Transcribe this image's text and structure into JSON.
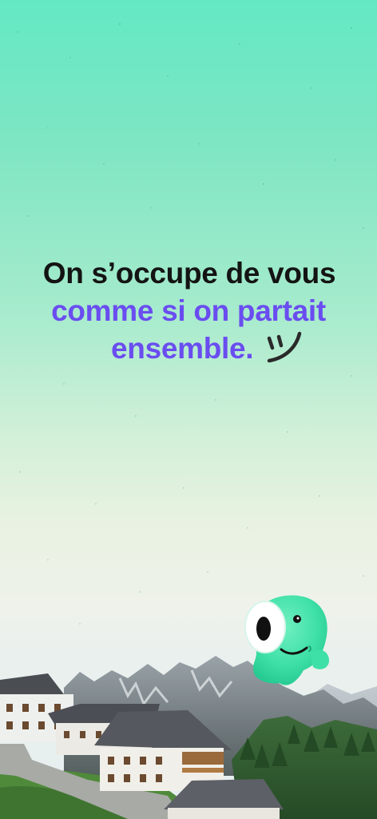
{
  "headline": {
    "line1": "On s’occupe de vous",
    "line2": "comme si on partait",
    "line3": "ensemble."
  },
  "decorations": {
    "smiley": "smiley-doodle-icon",
    "mascot": "green-blob-mascot",
    "background": "mountain-village-photo"
  },
  "colors": {
    "gradient_top": "#64e8c4",
    "gradient_bottom": "#e6eef0",
    "text_dark": "#141414",
    "text_accent": "#6a4df0",
    "mascot_green": "#3fe0a8"
  }
}
